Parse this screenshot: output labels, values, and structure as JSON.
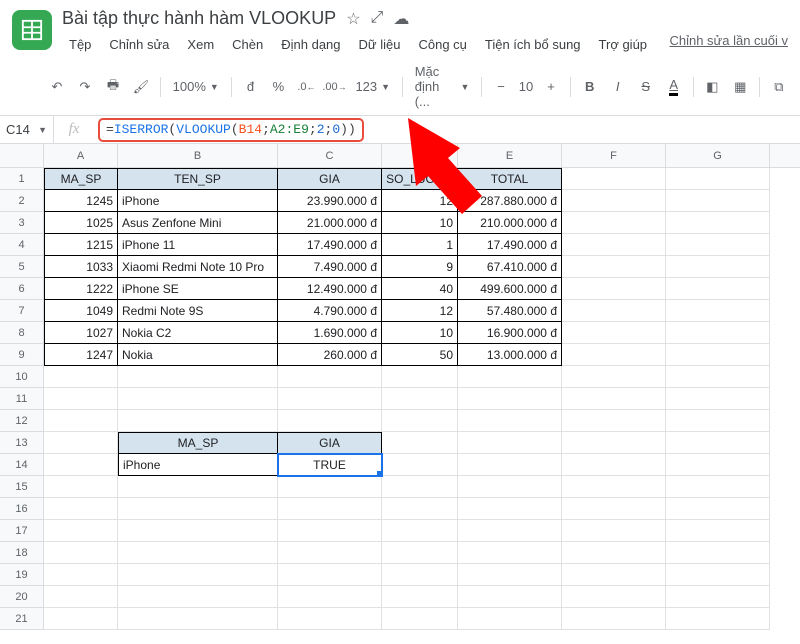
{
  "doc": {
    "title": "Bài tập thực hành hàm VLOOKUP",
    "menus": [
      "Tệp",
      "Chỉnh sửa",
      "Xem",
      "Chèn",
      "Định dạng",
      "Dữ liệu",
      "Công cụ",
      "Tiện ích bổ sung",
      "Trợ giúp"
    ],
    "last_edit": "Chỉnh sửa lần cuối v"
  },
  "toolbar": {
    "zoom": "100%",
    "currency": "đ",
    "percent": "%",
    "dec_dec": ".0",
    "dec_inc": ".00",
    "format": "123",
    "font": "Mặc định (...",
    "font_size": "10"
  },
  "name_box": "C14",
  "formula": {
    "head": "=",
    "fn1": "ISERROR",
    "p1": "(",
    "fn2": "VLOOKUP",
    "p2": "(",
    "ref1": "B14",
    "sc1": ";",
    "ref2": "A2:E9",
    "sc2": ";",
    "n1": "2",
    "sc3": ";",
    "n2": "0",
    "p3": ")",
    "p4": ")"
  },
  "cols": [
    "A",
    "B",
    "C",
    "D",
    "E",
    "F",
    "G"
  ],
  "row_count": 21,
  "headers": {
    "ma_sp": "MA_SP",
    "ten_sp": "TEN_SP",
    "gia": "GIA",
    "so_luong": "SO_LUONG",
    "total": "TOTAL"
  },
  "data": [
    {
      "ma_sp": "1245",
      "ten_sp": "iPhone",
      "gia": "23.990.000 đ",
      "so_luong": "12",
      "total": "287.880.000 đ"
    },
    {
      "ma_sp": "1025",
      "ten_sp": "Asus Zenfone Mini",
      "gia": "21.000.000 đ",
      "so_luong": "10",
      "total": "210.000.000 đ"
    },
    {
      "ma_sp": "1215",
      "ten_sp": "iPhone 11",
      "gia": "17.490.000 đ",
      "so_luong": "1",
      "total": "17.490.000 đ"
    },
    {
      "ma_sp": "1033",
      "ten_sp": "Xiaomi Redmi Note 10 Pro",
      "gia": "7.490.000 đ",
      "so_luong": "9",
      "total": "67.410.000 đ"
    },
    {
      "ma_sp": "1222",
      "ten_sp": "iPhone SE",
      "gia": "12.490.000 đ",
      "so_luong": "40",
      "total": "499.600.000 đ"
    },
    {
      "ma_sp": "1049",
      "ten_sp": "Redmi Note 9S",
      "gia": "4.790.000 đ",
      "so_luong": "12",
      "total": "57.480.000 đ"
    },
    {
      "ma_sp": "1027",
      "ten_sp": "Nokia C2",
      "gia": "1.690.000 đ",
      "so_luong": "10",
      "total": "16.900.000 đ"
    },
    {
      "ma_sp": "1247",
      "ten_sp": "Nokia",
      "gia": "260.000 đ",
      "so_luong": "50",
      "total": "13.000.000 đ"
    }
  ],
  "lookup": {
    "hdr_ma": "MA_SP",
    "hdr_gia": "GIA",
    "val_ma": "iPhone",
    "val_gia": "TRUE"
  }
}
